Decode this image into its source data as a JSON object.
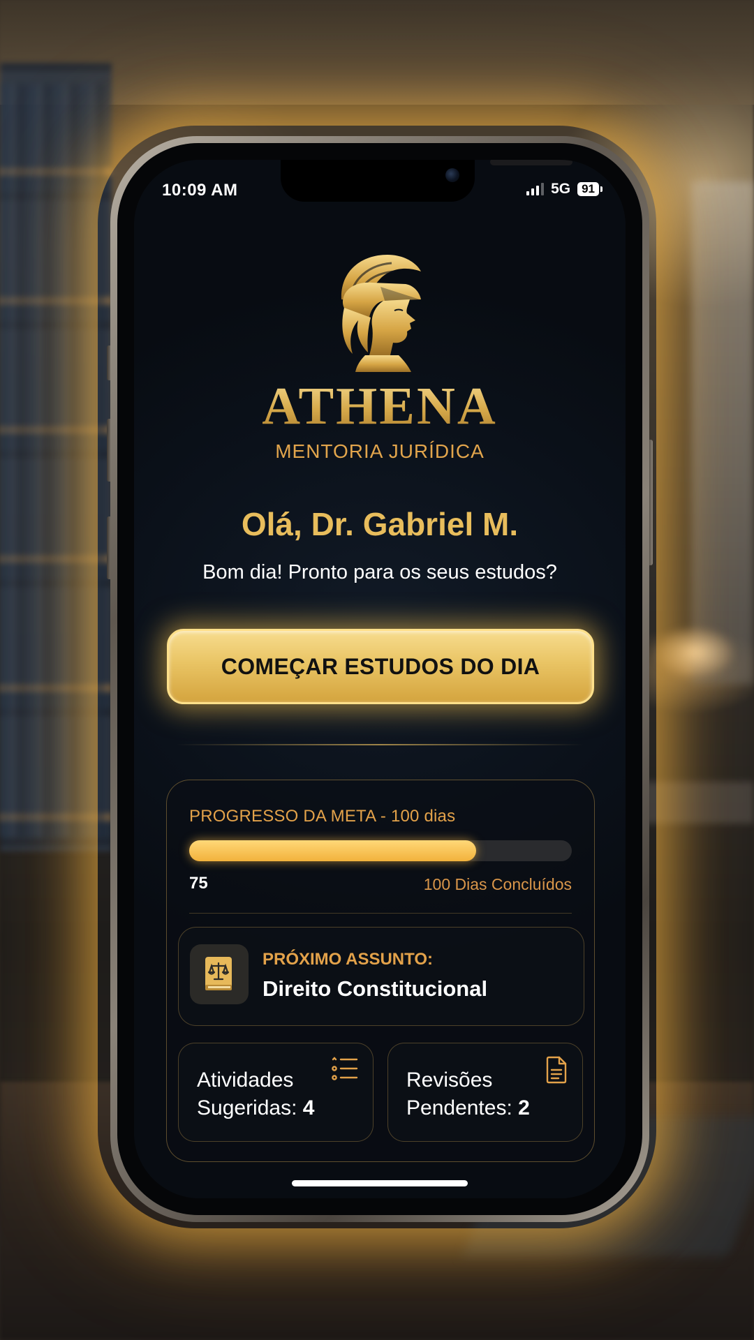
{
  "status_bar": {
    "time": "10:09 AM",
    "network": "5G",
    "battery": "91"
  },
  "brand": {
    "name": "ATHENA",
    "tagline": "MENTORIA JURÍDICA",
    "logo_icon": "athena-helmet-logo"
  },
  "greeting": {
    "title": "Olá, Dr. Gabriel M.",
    "subtitle": "Bom dia! Pronto para os seus estudos?"
  },
  "cta": {
    "label": "COMEÇAR ESTUDOS DO DIA"
  },
  "progress": {
    "title": "PROGRESSO DA META - 100 dias",
    "current": "75",
    "target_label": "100 Dias Concluídos",
    "value": 75,
    "max": 100
  },
  "next_subject": {
    "label": "PRÓXIMO ASSUNTO:",
    "value": "Direito Constitucional",
    "icon": "law-book-icon"
  },
  "suggested": {
    "line1": "Atividades",
    "line2": "Sugeridas:",
    "count": "4",
    "icon": "checklist-icon"
  },
  "reviews": {
    "line1": "Revisões",
    "line2": "Pendentes:",
    "count": "2",
    "icon": "document-icon"
  },
  "colors": {
    "gold": "#e8bd5c",
    "orange": "#e3a24a",
    "background": "#0b111a"
  }
}
